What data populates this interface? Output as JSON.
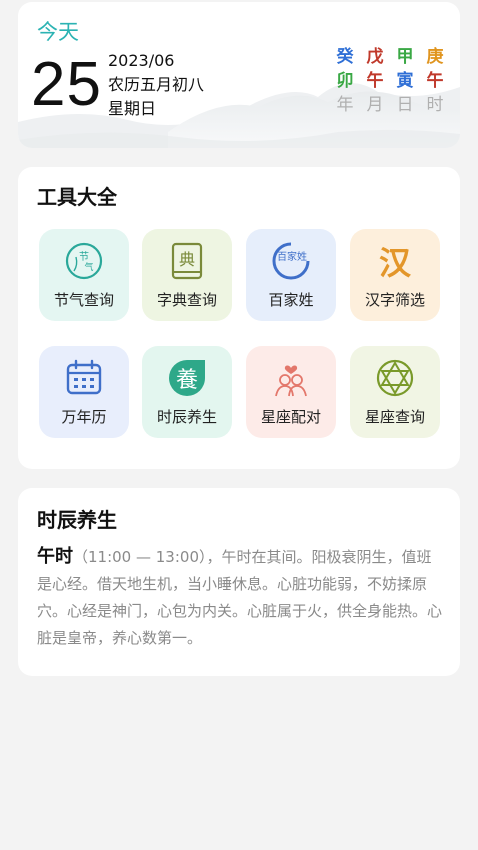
{
  "date_card": {
    "today_label": "今天",
    "day": "25",
    "year_month": "2023/06",
    "lunar": "农历五月初八",
    "weekday": "星期日",
    "ganzhi_top": [
      "癸",
      "戊",
      "甲",
      "庚"
    ],
    "ganzhi_bottom": [
      "卯",
      "午",
      "寅",
      "午"
    ],
    "ganzhi_labels": [
      "年",
      "月",
      "日",
      "时"
    ],
    "colors": {
      "today": "#2bb3b3",
      "gz_blue": "#2f6fd6",
      "gz_red": "#c0392b",
      "gz_green": "#3aa845",
      "gz_orange": "#e0951f",
      "gz_label": "#b0b0b0"
    }
  },
  "tools": {
    "title": "工具大全",
    "items": [
      {
        "label": "节气查询",
        "icon": "solar-term-icon",
        "bg": "#e4f6f2"
      },
      {
        "label": "字典查询",
        "icon": "dictionary-icon",
        "bg": "#eef5e2"
      },
      {
        "label": "百家姓",
        "icon": "surname-icon",
        "bg": "#e6eefb",
        "icon_text": "百家姓"
      },
      {
        "label": "汉字筛选",
        "icon": "hanzi-icon",
        "bg": "#fdefdc",
        "icon_text": "汉"
      },
      {
        "label": "万年历",
        "icon": "calendar-icon",
        "bg": "#e8eefc"
      },
      {
        "label": "时辰养生",
        "icon": "health-icon",
        "bg": "#e3f6ef",
        "icon_text": "養"
      },
      {
        "label": "星座配对",
        "icon": "couple-icon",
        "bg": "#fdebe8"
      },
      {
        "label": "星座查询",
        "icon": "star-icon",
        "bg": "#f1f5e4"
      }
    ]
  },
  "shichen": {
    "title": "时辰养生",
    "hour": "午时",
    "text": "（11:00 — 13:00），午时在其间。阳极衰阴生，值班是心经。借天地生机，当小睡休息。心脏功能弱，不妨揉原穴。心经是神门，心包为内关。心脏属于火，供全身能热。心脏是皇帝，养心数第一。"
  }
}
